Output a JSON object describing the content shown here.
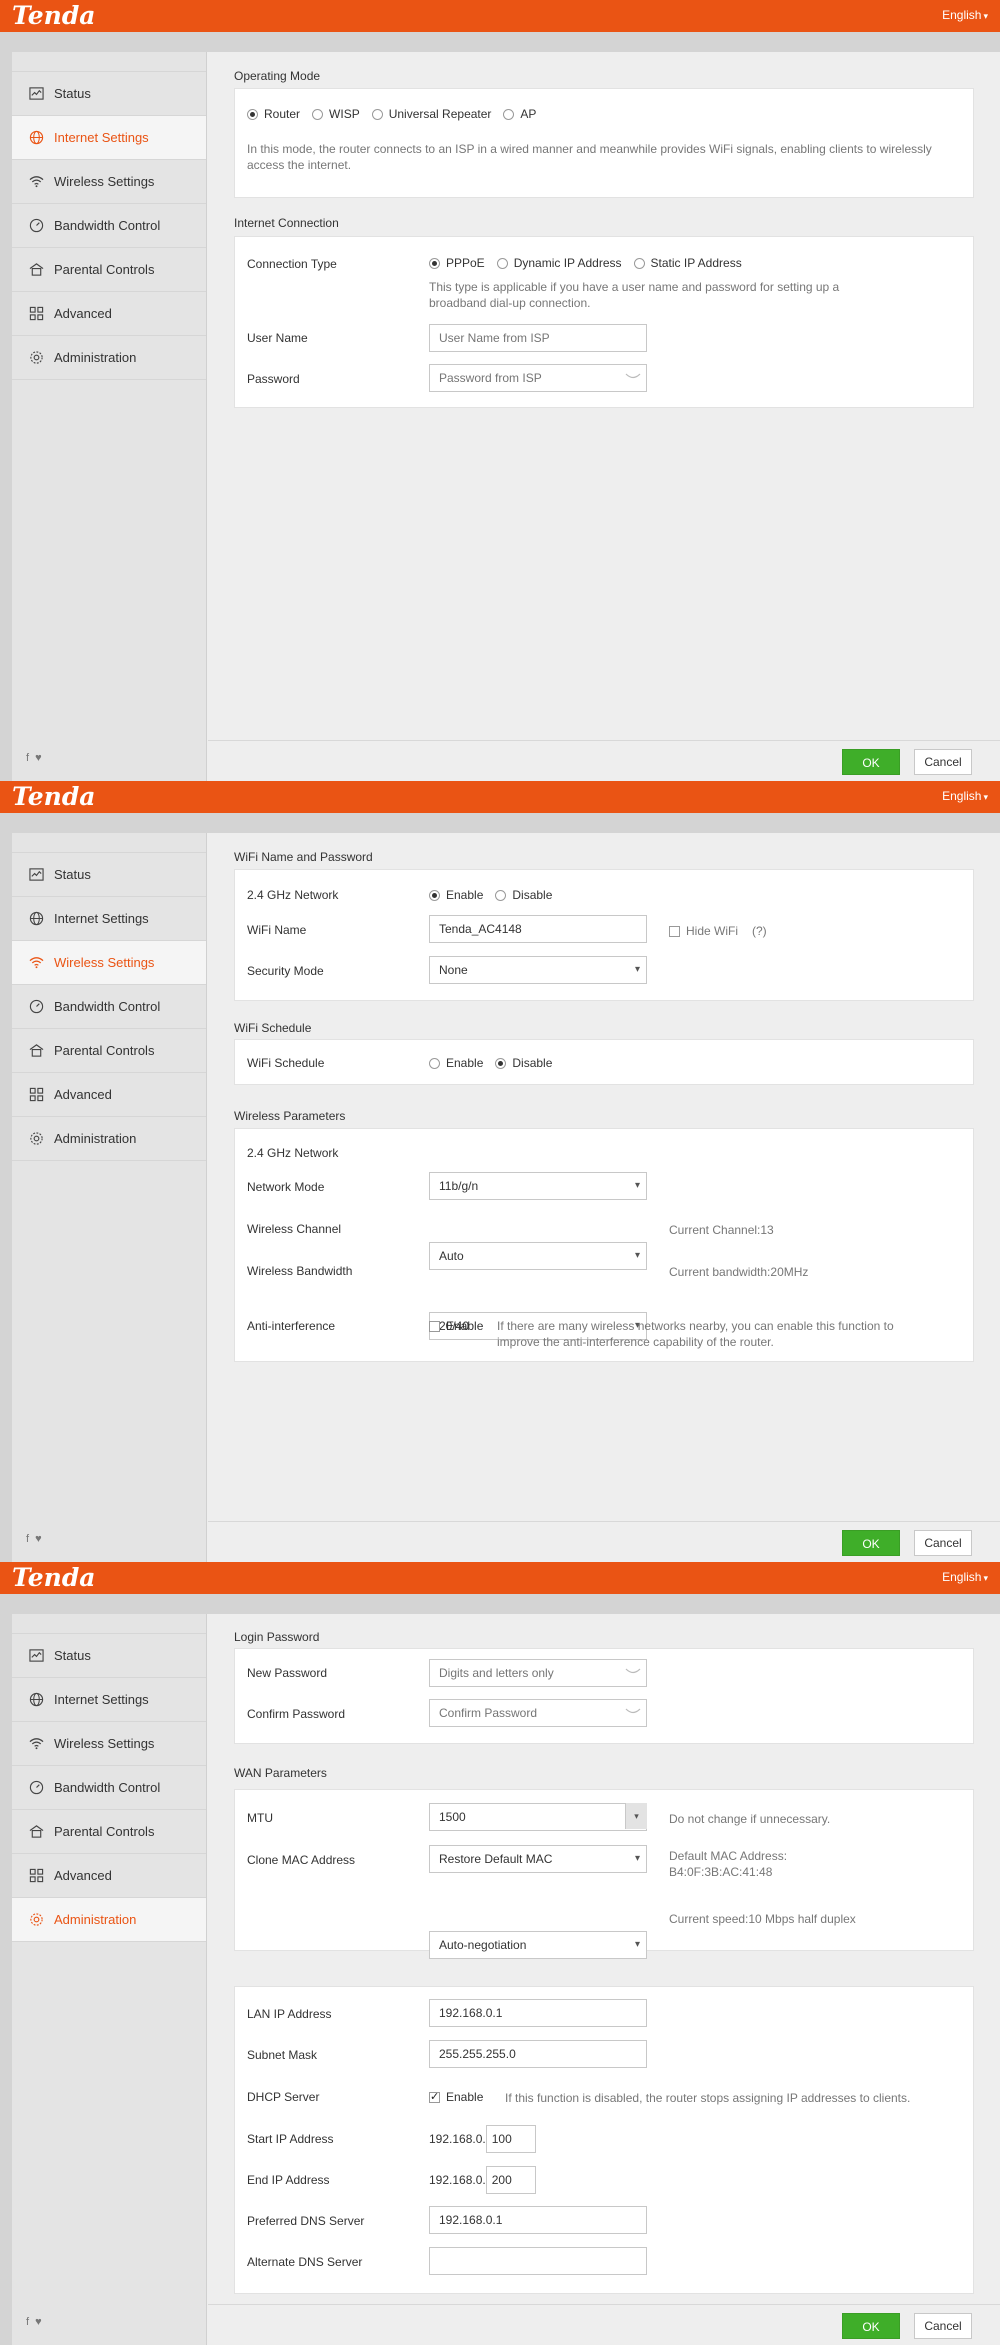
{
  "brand": {
    "logo": "Tenda",
    "language": "English"
  },
  "nav": {
    "status": "Status",
    "internet": "Internet Settings",
    "wireless": "Wireless Settings",
    "bandwidth": "Bandwidth Control",
    "parental": "Parental Controls",
    "advanced": "Advanced",
    "admin": "Administration"
  },
  "social": {
    "facebook": "f",
    "twitter": "🐦"
  },
  "buttons": {
    "ok": "OK",
    "cancel": "Cancel"
  },
  "colors": {
    "brand_orange": "#ea5414",
    "ok_green": "#3fae29"
  },
  "internet_page": {
    "operating_mode": {
      "title": "Operating Mode",
      "options": [
        "Router",
        "WISP",
        "Universal Repeater",
        "AP"
      ],
      "selected": "Router",
      "description": "In this mode, the router connects to an ISP in a wired manner and meanwhile provides WiFi signals, enabling clients to wirelessly access the internet."
    },
    "internet_connection": {
      "title": "Internet Connection",
      "connection_type_label": "Connection Type",
      "options": [
        "PPPoE",
        "Dynamic IP Address",
        "Static IP Address"
      ],
      "selected": "PPPoE",
      "description": "This type is applicable if you have a user name and password for setting up a broadband dial-up connection.",
      "username_label": "User Name",
      "username_placeholder": "User Name from ISP",
      "password_label": "Password",
      "password_placeholder": "Password from ISP"
    }
  },
  "wireless_page": {
    "wifi_name_password": {
      "title": "WiFi Name and Password",
      "network_label": "2.4 GHz Network",
      "enable": "Enable",
      "disable": "Disable",
      "network_state": "Enable",
      "wifi_name_label": "WiFi Name",
      "wifi_name_value": "Tenda_AC4148",
      "hide_wifi": "Hide WiFi",
      "help": "(?)",
      "security_label": "Security Mode",
      "security_value": "None"
    },
    "wifi_schedule": {
      "title": "WiFi Schedule",
      "label": "WiFi Schedule",
      "enable": "Enable",
      "disable": "Disable",
      "state": "Disable"
    },
    "wireless_parameters": {
      "title": "Wireless Parameters",
      "network_label": "2.4 GHz Network",
      "mode_label": "Network Mode",
      "mode_value": "11b/g/n",
      "channel_label": "Wireless Channel",
      "channel_value": "Auto",
      "current_channel": "Current Channel:13",
      "bandwidth_label": "Wireless Bandwidth",
      "bandwidth_value": "20/40",
      "current_bandwidth": "Current bandwidth:20MHz",
      "anti_label": "Anti-interference",
      "anti_enable": "Enable",
      "anti_hint": "If there are many wireless networks nearby, you can enable this function to improve the anti-interference capability of the router."
    }
  },
  "admin_page": {
    "login_password": {
      "title": "Login Password",
      "new_label": "New Password",
      "new_placeholder": "Digits and letters only",
      "confirm_label": "Confirm Password",
      "confirm_placeholder": "Confirm Password"
    },
    "wan_parameters": {
      "title": "WAN Parameters",
      "mtu_label": "MTU",
      "mtu_value": "1500",
      "mtu_hint": "Do not change if unnecessary.",
      "clone_label": "Clone MAC Address",
      "clone_value": "Restore Default MAC",
      "default_mac_label": "Default MAC Address:",
      "default_mac_value": "B4:0F:3B:AC:41:48",
      "speed_value": "Auto-negotiation",
      "current_speed": "Current speed:10 Mbps half duplex"
    },
    "lan": {
      "lan_ip_label": "LAN IP Address",
      "lan_ip_value": "192.168.0.1",
      "subnet_label": "Subnet Mask",
      "subnet_value": "255.255.255.0",
      "dhcp_label": "DHCP Server",
      "dhcp_enable": "Enable",
      "dhcp_hint": "If this function is disabled, the router stops assigning IP addresses to clients.",
      "start_label": "Start IP Address",
      "ip_prefix": "192.168.0.",
      "start_value": "100",
      "end_label": "End IP Address",
      "end_value": "200",
      "pref_dns_label": "Preferred DNS Server",
      "pref_dns_value": "192.168.0.1",
      "alt_dns_label": "Alternate DNS Server",
      "alt_dns_value": ""
    }
  }
}
